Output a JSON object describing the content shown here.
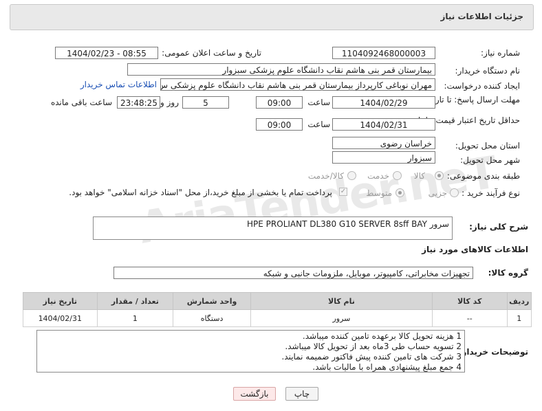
{
  "panel": {
    "title": "جزئیات اطلاعات نیاز"
  },
  "watermark": "AriaTender.neT",
  "need_number": {
    "label": "شماره نیاز:",
    "value": "1104092468000003"
  },
  "announce": {
    "label": "تاریخ و ساعت اعلان عمومی:",
    "value": "1404/02/23 - 08:55"
  },
  "buyer": {
    "label": "نام دستگاه خریدار:",
    "value": "بیمارستان قمر بنی هاشم نقاب   دانشگاه علوم پزشکی سبزوار"
  },
  "requester": {
    "label": "ایجاد کننده درخواست:",
    "value": "مهران نوباغی کارپرداز بیمارستان قمر بنی هاشم نقاب   دانشگاه علوم پزشکی س",
    "contact_link": "اطلاعات تماس خریدار"
  },
  "deadline": {
    "label": "مهلت ارسال پاسخ: تا تاریخ:",
    "date": "1404/02/29",
    "time_label": "ساعت",
    "time": "09:00",
    "days": "5",
    "days_label": "روز و",
    "remaining": "23:48:25",
    "remaining_label": "ساعت باقی مانده"
  },
  "validity": {
    "label": "حداقل تاریخ اعتبار قیمت: تا تاریخ:",
    "date": "1404/02/31",
    "time_label": "ساعت",
    "time": "09:00"
  },
  "province": {
    "label": "استان محل تحویل:",
    "value": "خراسان رضوی"
  },
  "city": {
    "label": "شهر محل تحویل:",
    "value": "سبزوار"
  },
  "category": {
    "label": "طبقه بندی موضوعی:",
    "options": [
      "کالا",
      "خدمت",
      "کالا/خدمت"
    ],
    "selected": "کالا"
  },
  "process": {
    "label": "نوع فرآیند خرید :",
    "options": [
      "جزیی",
      "متوسط"
    ],
    "selected": "متوسط",
    "payment_note": "پرداخت تمام یا بخشی از مبلغ خرید،از محل \"اسناد خزانه اسلامی\" خواهد بود."
  },
  "description": {
    "label": "شرح کلی نیاز:",
    "value": "سرور HPE PROLIANT DL380 G10 SERVER 8sff BAY"
  },
  "goods_info": {
    "title": "اطلاعات کالاهای مورد نیاز"
  },
  "goods_group": {
    "label": "گروه کالا:",
    "value": "تجهیزات مخابراتی، کامپیوتر، موبایل، ملزومات جانبی و شبکه"
  },
  "table": {
    "headers": [
      "ردیف",
      "کد کالا",
      "نام کالا",
      "واحد شمارش",
      "تعداد / مقدار",
      "تاریخ نیاز"
    ],
    "rows": [
      [
        "1",
        "--",
        "سرور",
        "دستگاه",
        "1",
        "1404/02/31"
      ]
    ]
  },
  "buyer_notes": {
    "label": "توضیحات خریدار:",
    "lines": [
      "1 هزینه تحویل کالا برعهده تامین کننده میباشد.",
      "2 تسویه حساب طی 3ماه بعد از تحویل کالا میباشد.",
      "3 شرکت های  تامین کننده پیش فاکتور ضمیمه نمایند.",
      "4 جمع مبلغ پیشنهادی همراه با مالیات باشد."
    ]
  },
  "buttons": {
    "print": "چاپ",
    "back": "بازگشت"
  }
}
